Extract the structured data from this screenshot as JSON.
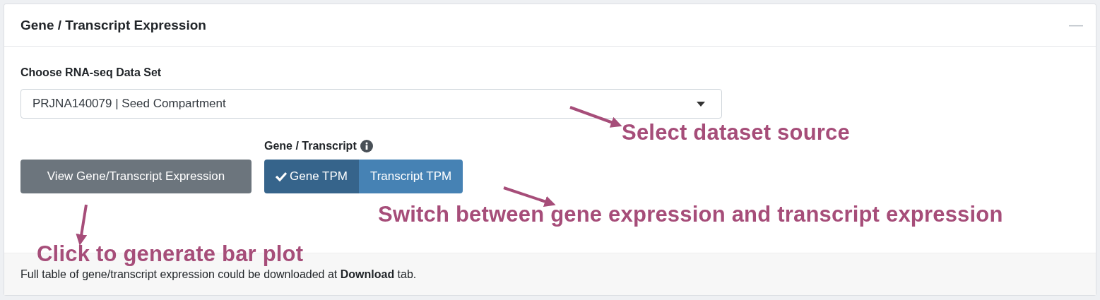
{
  "panel": {
    "title": "Gene / Transcript Expression",
    "collapse_symbol": "—"
  },
  "dataset": {
    "label": "Choose RNA-seq Data Set",
    "value": "PRJNA140079 | Seed Compartment"
  },
  "view_button": {
    "label": "View Gene/Transcript Expression"
  },
  "toggle": {
    "label": "Gene / Transcript",
    "options": [
      {
        "label": "Gene TPM",
        "selected": true
      },
      {
        "label": "Transcript TPM",
        "selected": false
      }
    ]
  },
  "footer": {
    "text": "Full table of gene/transcript expression could be downloaded at **Download** tab."
  },
  "annotations": [
    {
      "kind": "select",
      "text": "Select dataset source"
    },
    {
      "kind": "toggle",
      "text": "Switch between gene expression and transcript expression"
    },
    {
      "kind": "button",
      "text": "Click to generate bar plot"
    }
  ]
}
